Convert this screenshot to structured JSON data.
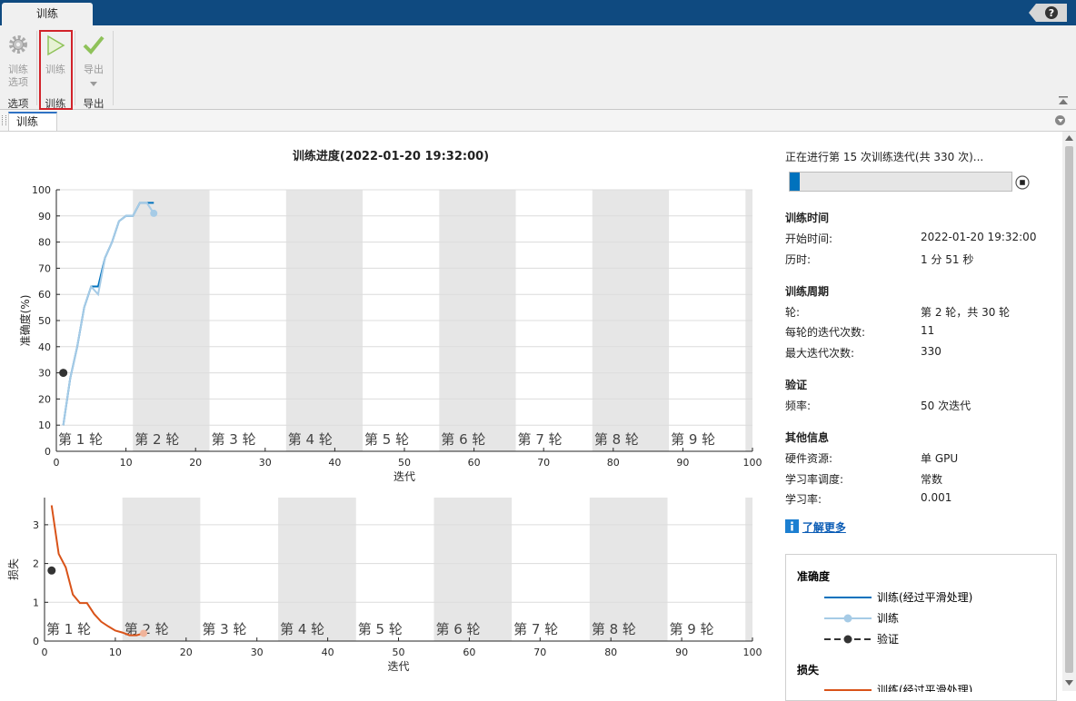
{
  "top": {
    "tab_label": "训练",
    "help_label": "?"
  },
  "toolstrip": {
    "options_label": "训练选项",
    "options_group": "选项",
    "train_label": "训练",
    "train_group": "训练",
    "export_label": "导出",
    "export_group": "导出"
  },
  "doc": {
    "tab_label": "训练"
  },
  "colors": {
    "accent_blue": "#0072bd",
    "light_blue": "#a6cbe6",
    "orange": "#d95319",
    "validation": "#333333",
    "epoch_shade": "#e6e6e6"
  },
  "chart": {
    "title": "训练进度(2022-01-20 19:32:00)",
    "xlabel": "迭代",
    "epoch_labels": [
      "第 1 轮",
      "第 2 轮",
      "第 3 轮",
      "第 4 轮",
      "第 5 轮",
      "第 6 轮",
      "第 7 轮",
      "第 8 轮",
      "第 9 轮"
    ]
  },
  "chart_data": [
    {
      "type": "line",
      "ylabel": "准确度(%)",
      "xlabel": "迭代",
      "xlim": [
        0,
        100
      ],
      "ylim": [
        0,
        100
      ],
      "xticks": [
        0,
        10,
        20,
        30,
        40,
        50,
        60,
        70,
        80,
        90,
        100
      ],
      "yticks": [
        0,
        10,
        20,
        30,
        40,
        50,
        60,
        70,
        80,
        90,
        100
      ],
      "epoch_length": 11,
      "series": [
        {
          "name": "训练(经过平滑处理)",
          "x": [
            1,
            2,
            3,
            4,
            5,
            6,
            7,
            8,
            9,
            10,
            11,
            12,
            13,
            14
          ],
          "y": [
            10,
            28,
            40,
            55,
            63,
            63,
            74,
            80,
            88,
            90,
            90,
            95,
            95,
            95
          ]
        },
        {
          "name": "训练",
          "x": [
            1,
            2,
            3,
            4,
            5,
            6,
            7,
            8,
            9,
            10,
            11,
            12,
            13,
            14
          ],
          "y": [
            10,
            28,
            40,
            55,
            63,
            60,
            74,
            80,
            88,
            90,
            90,
            95,
            95,
            91
          ]
        },
        {
          "name": "验证",
          "x": [
            1
          ],
          "y": [
            30
          ]
        }
      ]
    },
    {
      "type": "line",
      "ylabel": "损失",
      "xlabel": "迭代",
      "xlim": [
        0,
        100
      ],
      "ylim": [
        0,
        3.7
      ],
      "xticks": [
        0,
        10,
        20,
        30,
        40,
        50,
        60,
        70,
        80,
        90,
        100
      ],
      "yticks": [
        0,
        1,
        2,
        3
      ],
      "epoch_length": 11,
      "series": [
        {
          "name": "训练(经过平滑处理)",
          "x": [
            1,
            2,
            3,
            4,
            5,
            6,
            7,
            8,
            9,
            10,
            11,
            12,
            13,
            14
          ],
          "y": [
            3.5,
            2.25,
            1.9,
            1.2,
            0.98,
            0.98,
            0.7,
            0.5,
            0.38,
            0.27,
            0.22,
            0.15,
            0.15,
            0.2
          ]
        },
        {
          "name": "验证",
          "x": [
            1
          ],
          "y": [
            1.82
          ]
        }
      ]
    }
  ],
  "info": {
    "status": "正在进行第 15 次训练迭代(共 330 次)...",
    "progress": 0.045,
    "time_header": "训练时间",
    "start_label": "开始时间:",
    "start_value": "2022-01-20 19:32:00",
    "elapsed_label": "历时:",
    "elapsed_value": "1 分 51 秒",
    "cycle_header": "训练周期",
    "epoch_label": "轮:",
    "epoch_value": "第 2 轮，共 30 轮",
    "iter_per_epoch_label": "每轮的迭代次数:",
    "iter_per_epoch_value": "11",
    "max_iter_label": "最大迭代次数:",
    "max_iter_value": "330",
    "val_header": "验证",
    "freq_label": "频率:",
    "freq_value": "50 次迭代",
    "other_header": "其他信息",
    "hw_label": "硬件资源:",
    "hw_value": "单 GPU",
    "lr_sched_label": "学习率调度:",
    "lr_sched_value": "常数",
    "lr_label": "学习率:",
    "lr_value": "0.001",
    "learn_more": "了解更多"
  },
  "legend": {
    "acc_header": "准确度",
    "acc_smoothed": "训练(经过平滑处理)",
    "acc_train": "训练",
    "acc_val": "验证",
    "loss_header": "损失",
    "loss_smoothed": "训练(经过平滑处理)"
  }
}
